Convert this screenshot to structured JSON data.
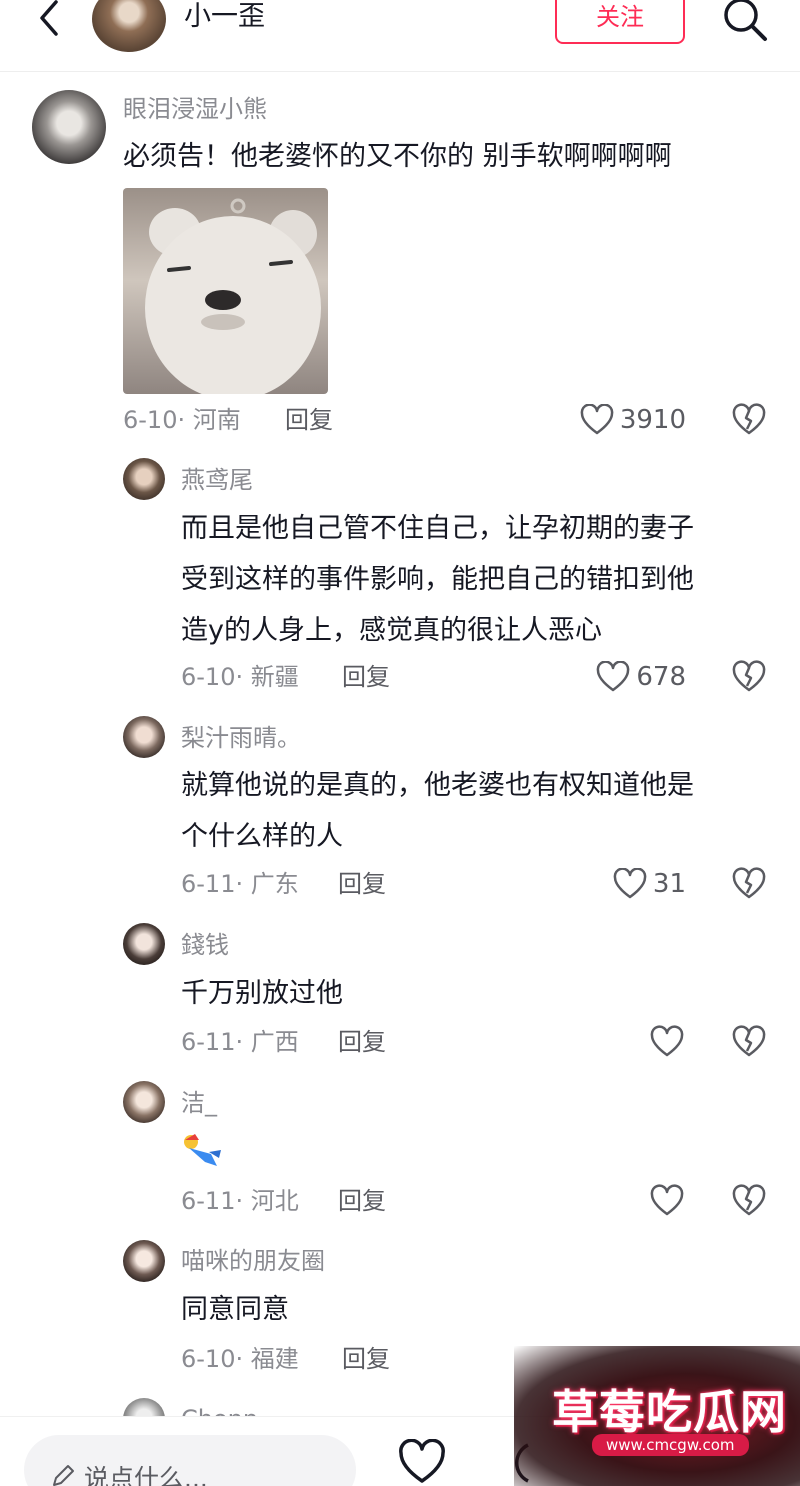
{
  "header": {
    "username": "小一歪",
    "follow_label": "关注"
  },
  "comments": [
    {
      "user": "眼泪浸湿小熊",
      "lines": [
        "必须告！他老婆怀的又不你的 别手软啊啊啊啊"
      ],
      "date_location": "6-10· 河南",
      "reply_label": "回复",
      "likes": "3910",
      "has_sticker": true
    }
  ],
  "replies": [
    {
      "user": "燕鸢尾",
      "lines": [
        "而且是他自己管不住自己，让孕初期的妻子",
        "受到这样的事件影响，能把自己的错扣到他",
        "造y的人身上，感觉真的很让人恶心"
      ],
      "date_location": "6-10· 新疆",
      "reply_label": "回复",
      "likes": "678"
    },
    {
      "user": "梨汁雨晴。",
      "lines": [
        "就算他说的是真的，他老婆也有权知道他是",
        "个什么样的人"
      ],
      "date_location": "6-11· 广东",
      "reply_label": "回复",
      "likes": "31"
    },
    {
      "user": "錢钱",
      "lines": [
        "千万别放过他"
      ],
      "date_location": "6-11· 广西",
      "reply_label": "回复",
      "likes": ""
    },
    {
      "user": "洁_",
      "lines": [],
      "date_location": "6-11· 河北",
      "reply_label": "回复",
      "likes": ""
    },
    {
      "user": "喵咪的朋友圈",
      "lines": [
        "同意同意"
      ],
      "date_location": "6-10· 福建",
      "reply_label": "回复",
      "likes": ""
    },
    {
      "user": "Chonn",
      "lines": [],
      "date_location": "",
      "reply_label": "",
      "likes": ""
    }
  ],
  "bottom_bar": {
    "input_placeholder": "说点什么..."
  },
  "watermark": {
    "title": "草莓吃瓜网",
    "url": "www.cmcgw.com"
  },
  "colors": {
    "accent": "#fe2c55",
    "text_primary": "#161823",
    "text_secondary": "#8a8b91"
  }
}
